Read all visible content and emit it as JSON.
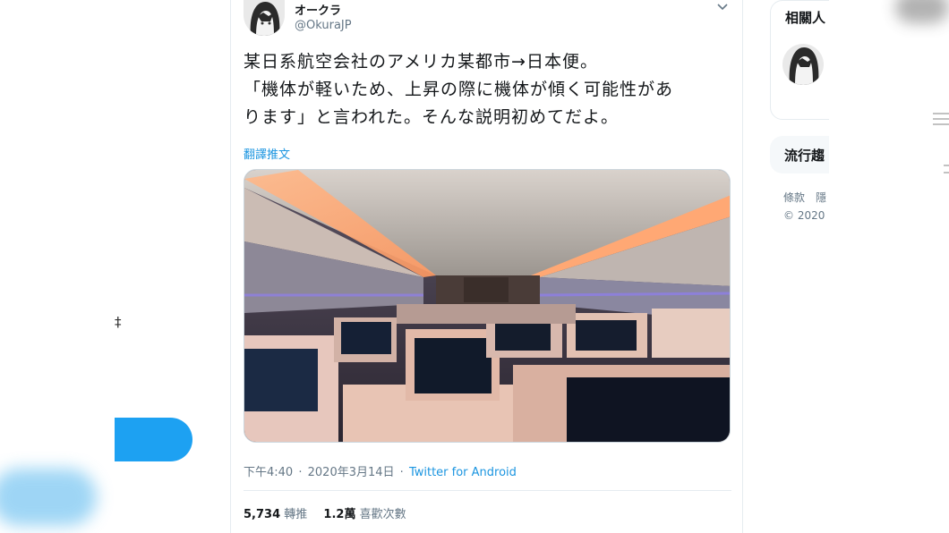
{
  "left_nav": {
    "partial_glyph": "‡"
  },
  "tweet": {
    "display_name": "オークラ",
    "username": "@OkuraJP",
    "text_lines": [
      "某日系航空会社のアメリカ某都市→日本便。",
      "「機体が軽いため、上昇の際に機体が傾く可能性があ",
      "ります」と言われた。そんな説明初めてだよ。"
    ],
    "translate_label": "翻譯推文",
    "time": "下午4:40",
    "date": "2020年3月14日",
    "meta_sep": "·",
    "source": "Twitter for Android",
    "retweets_count": "5,734",
    "retweets_label": "轉推",
    "likes_count": "1.2萬",
    "likes_label": "喜歡次數"
  },
  "sidebar": {
    "who_title": "相關人",
    "trends_title": "流行趨",
    "footer_links": "條款　隱",
    "copyright": "© 2020"
  },
  "colors": {
    "accent": "#1da1f2",
    "link": "#1b95e0",
    "secondary_text": "#657786"
  },
  "icons": {
    "caret": "chevron-down-icon",
    "tweet_button": "compose-button"
  }
}
